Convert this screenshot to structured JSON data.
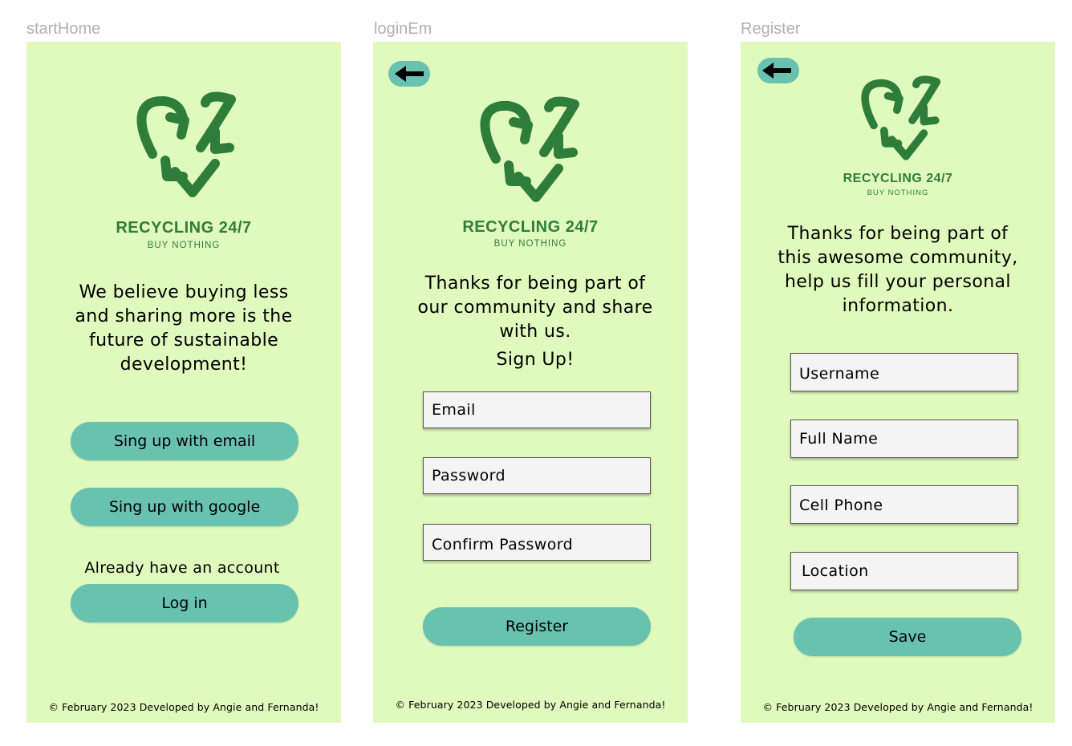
{
  "frames": [
    {
      "label": "startHome",
      "brand": {
        "name": "RECYCLING 24/7",
        "tagline": "BUY NOTHING"
      },
      "intro_lines": [
        "We believe buying less",
        "and sharing more  is the",
        "future of sustainable",
        "development!"
      ],
      "buttons": {
        "email_signup": "Sing up with email",
        "google_signup": "Sing up with google",
        "login": "Log in"
      },
      "account_prompt": "Already have  an account",
      "footer": "© February 2023 Developed by Angie and Fernanda!"
    },
    {
      "label": "loginEm",
      "back_icon": "arrow-left-icon",
      "brand": {
        "name": "RECYCLING 24/7",
        "tagline": "BUY NOTHING"
      },
      "intro_lines": [
        "Thanks for being part of",
        "our community and share",
        "with us."
      ],
      "signup_heading": "Sign Up!",
      "fields": {
        "email": "Email",
        "password": "Password",
        "confirm_password": "Confirm Password"
      },
      "register_button": "Register",
      "footer": "© February 2023 Developed by Angie and Fernanda!"
    },
    {
      "label": "Register",
      "back_icon": "arrow-left-icon",
      "brand": {
        "name": "RECYCLING 24/7",
        "tagline": "BUY NOTHING"
      },
      "intro_lines": [
        "Thanks for being part of",
        "this awesome community,",
        "help us fill your personal",
        "information."
      ],
      "fields": {
        "username": "Username",
        "full_name": "Full Name",
        "cell_phone": "Cell Phone",
        "location": "Location"
      },
      "save_button": "Save",
      "footer": "© February 2023 Developed by Angie and Fernanda!"
    }
  ],
  "colors": {
    "screen_bg": "#dffabc",
    "button": "#69c2b0",
    "logo_green": "#2f7d3a",
    "field_bg": "#f4f4f4",
    "frame_label": "#b0b0b0"
  }
}
